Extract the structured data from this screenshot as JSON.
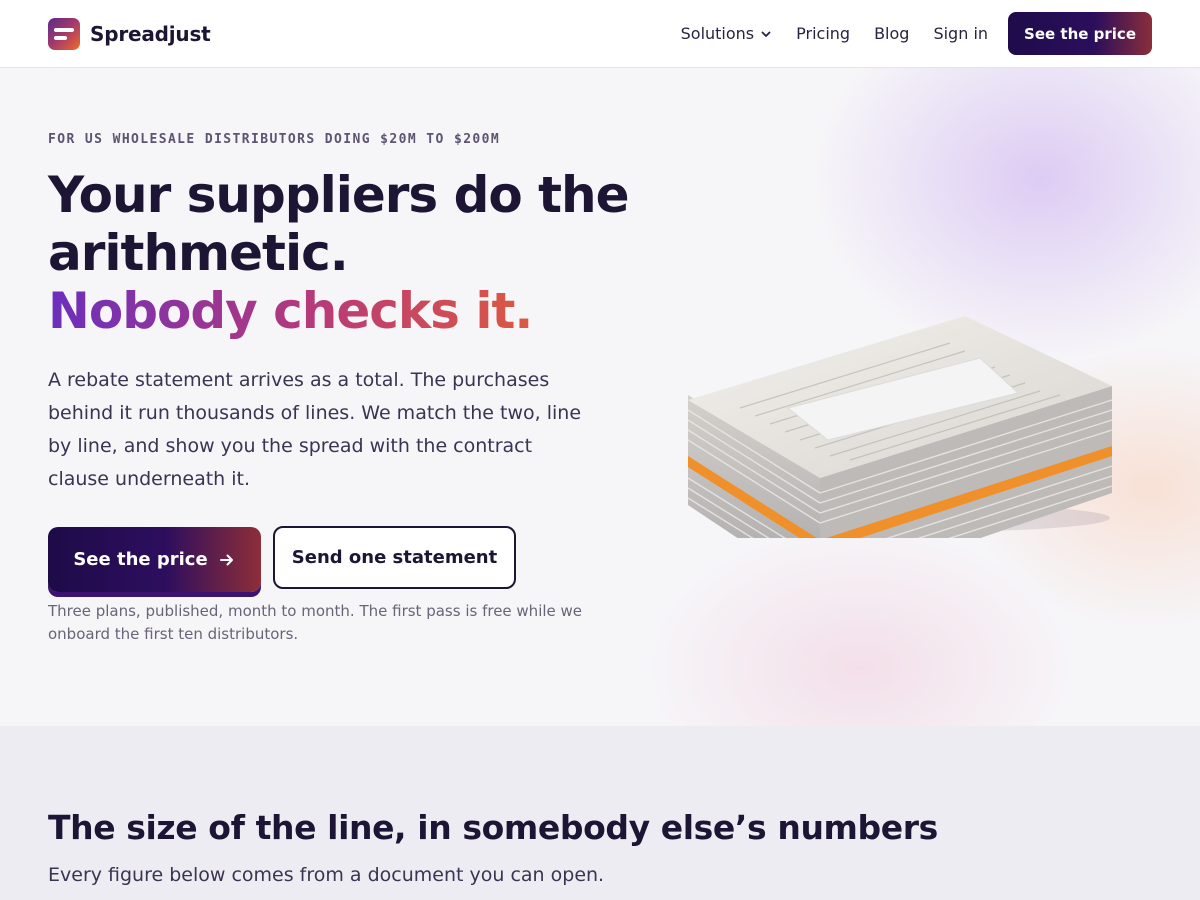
{
  "header": {
    "brand": "Spreadjust",
    "nav": [
      {
        "label": "Solutions",
        "has_dropdown": true
      },
      {
        "label": "Pricing"
      },
      {
        "label": "Blog"
      },
      {
        "label": "Sign in"
      }
    ],
    "cta_label": "See the price"
  },
  "hero": {
    "eyebrow": "FOR US WHOLESALE DISTRIBUTORS DOING $20M TO $200M",
    "headline_line1": "Your suppliers do the arithmetic.",
    "headline_accent": "Nobody checks it.",
    "lede": "A rebate statement arrives as a total. The purchases behind it run thousands of lines. We match the two, line by line, and show you the spread with the contract clause underneath it.",
    "primary_cta": "See the price",
    "primary_cta_icon": "arrow-right-icon",
    "secondary_cta": "Send one statement",
    "note": "Three plans, published, month to month. The first pass is free while we onboard the first ten distributors."
  },
  "section2": {
    "title": "The size of the line, in somebody else’s numbers",
    "subtitle": "Every figure below comes from a document you can open."
  },
  "colors": {
    "ink": "#1c1533",
    "accent_purple": "#6b2fbd",
    "accent_orange": "#f06a22",
    "cta_dark": "#1f0c4a"
  }
}
